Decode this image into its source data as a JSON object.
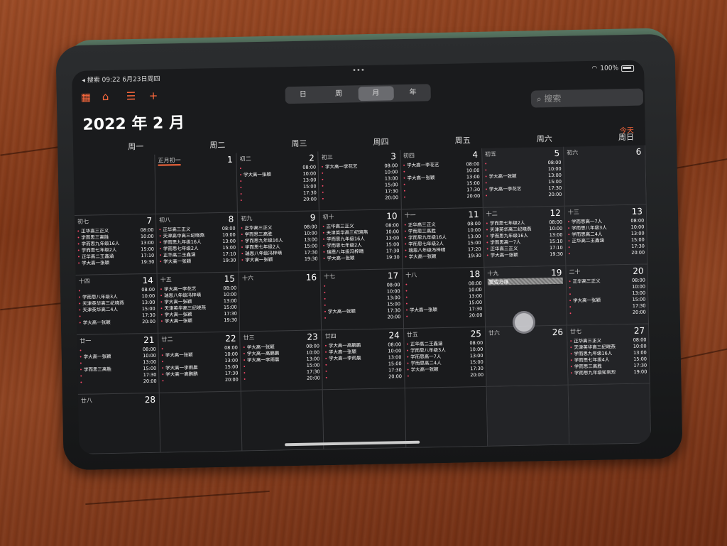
{
  "status": {
    "back": "◂ 搜索",
    "time": "09:22",
    "date": "6月23日周四",
    "battery": "100%"
  },
  "toolbar": {
    "seg": [
      "日",
      "周",
      "月",
      "年"
    ],
    "selected": 2,
    "search_placeholder": "搜索"
  },
  "month_title": "2022 年 2 月",
  "today_label": "今天",
  "weekdays": [
    "周一",
    "周二",
    "周三",
    "周四",
    "周五",
    "周六",
    "周日"
  ],
  "times_a": [
    "08:00",
    "10:00",
    "13:00",
    "15:00",
    "17:30",
    "20:00"
  ],
  "rows": [
    [
      {
        "lunar": "",
        "num": "",
        "ev": []
      },
      {
        "lunar": "正月初一",
        "num": "1",
        "hl": true,
        "ev": []
      },
      {
        "lunar": "初二",
        "num": "2",
        "ev": [
          [
            "",
            "08:00"
          ],
          [
            "学大高一张颖",
            "10:00"
          ],
          [
            "",
            "13:00"
          ],
          [
            "",
            "15:00"
          ],
          [
            "",
            "17:30"
          ],
          [
            "",
            "20:00"
          ]
        ]
      },
      {
        "lunar": "初三",
        "num": "3",
        "ev": [
          [
            "学大高一李花艺",
            "08:00"
          ],
          [
            "",
            "10:00"
          ],
          [
            "",
            "13:00"
          ],
          [
            "",
            "15:00"
          ],
          [
            "",
            "17:30"
          ],
          [
            "",
            "20:00"
          ]
        ]
      },
      {
        "lunar": "初四",
        "num": "4",
        "ev": [
          [
            "学大高一李花艺",
            "08:00"
          ],
          [
            "",
            "10:00"
          ],
          [
            "学大高一张颖",
            "13:00"
          ],
          [
            "",
            "15:00"
          ],
          [
            "",
            "17:30"
          ],
          [
            "",
            "20:00"
          ]
        ]
      },
      {
        "lunar": "初五",
        "num": "5",
        "ev": [
          [
            "",
            "08:00"
          ],
          [
            "",
            "10:00"
          ],
          [
            "学大高一张颖",
            "13:00"
          ],
          [
            "",
            "15:00"
          ],
          [
            "学大高一李花艺",
            "17:30"
          ],
          [
            "",
            "20:00"
          ]
        ]
      },
      {
        "lunar": "初六",
        "num": "6",
        "ev": []
      }
    ],
    [
      {
        "lunar": "初七",
        "num": "7",
        "ev": [
          [
            "正华高三正义",
            "08:00"
          ],
          [
            "学而思三高胜",
            "10:00"
          ],
          [
            "学而思九年级16人",
            "13:00"
          ],
          [
            "学而思七年级2人",
            "15:00"
          ],
          [
            "正华高二王鑫涵",
            "17:10"
          ],
          [
            "学大高一张颖",
            "19:30"
          ]
        ]
      },
      {
        "lunar": "初八",
        "num": "8",
        "ev": [
          [
            "正华高三正义",
            "08:00"
          ],
          [
            "天津高中高三纪晓燕",
            "10:00"
          ],
          [
            "学而思九年级16人",
            "13:00"
          ],
          [
            "学而思七年级2人",
            "15:00"
          ],
          [
            "正华高二王鑫涵",
            "17:10"
          ],
          [
            "学大高一张颖",
            "19:30"
          ]
        ]
      },
      {
        "lunar": "初九",
        "num": "9",
        "ev": [
          [
            "正华高三正义",
            "08:00"
          ],
          [
            "学而思三高胜",
            "10:00"
          ],
          [
            "学而思九年级16人",
            "13:00"
          ],
          [
            "学而思七年级2人",
            "15:00"
          ],
          [
            "瑞恩八年级冯梓晴",
            "17:30"
          ],
          [
            "学大高一张颖",
            "19:30"
          ]
        ]
      },
      {
        "lunar": "初十",
        "num": "10",
        "ev": [
          [
            "正华高三正义",
            "08:00"
          ],
          [
            "天津英华高三纪晓燕",
            "10:00"
          ],
          [
            "学而思九年级16人",
            "13:00"
          ],
          [
            "学而思七年级2人",
            "15:00"
          ],
          [
            "瑞恩八年级冯梓晴",
            "17:30"
          ],
          [
            "学大高一张颖",
            "19:30"
          ]
        ]
      },
      {
        "lunar": "十一",
        "num": "11",
        "ev": [
          [
            "正华高三正义",
            "08:00"
          ],
          [
            "学而思三高胜",
            "10:00"
          ],
          [
            "学而思九年级16人",
            "13:00"
          ],
          [
            "学而思七年级2人",
            "15:00"
          ],
          [
            "瑞恩八年级冯梓晴",
            "17:20"
          ],
          [
            "学大高一张颖",
            "19:30"
          ]
        ]
      },
      {
        "lunar": "十二",
        "num": "12",
        "ev": [
          [
            "学而思七年级2人",
            "08:00"
          ],
          [
            "天津英华高三纪晓燕",
            "10:00"
          ],
          [
            "学而思九年级16人",
            "13:00"
          ],
          [
            "学而思高一7人",
            "15:10"
          ],
          [
            "正华高三正义",
            "17:10"
          ],
          [
            "学大高一张颖",
            "19:30"
          ]
        ]
      },
      {
        "lunar": "十三",
        "num": "13",
        "ev": [
          [
            "学而思高一7人",
            "08:00"
          ],
          [
            "学而思八年级3人",
            "10:00"
          ],
          [
            "学而思高二4人",
            "13:00"
          ],
          [
            "正华高二王鑫涵",
            "15:00"
          ],
          [
            "",
            "17:30"
          ],
          [
            "",
            "20:00"
          ]
        ]
      }
    ],
    [
      {
        "lunar": "十四",
        "num": "14",
        "ev": [
          [
            "",
            "08:00"
          ],
          [
            "学而思八年级3人",
            "10:00"
          ],
          [
            "天津英华高三纪晓燕",
            "13:00"
          ],
          [
            "天津英华高二4人",
            "15:00"
          ],
          [
            "",
            "17:30"
          ],
          [
            "学大高一张颖",
            "20:00"
          ]
        ]
      },
      {
        "lunar": "十五",
        "num": "15",
        "ev": [
          [
            "学大高一李花艺",
            "08:00"
          ],
          [
            "瑞恩八年级冯梓晴",
            "10:00"
          ],
          [
            "学大高一张颖",
            "13:00"
          ],
          [
            "天津英华高三纪晓燕",
            "15:00"
          ],
          [
            "学大高一张颖",
            "17:30"
          ],
          [
            "学大高一张颖",
            "19:30"
          ]
        ]
      },
      {
        "lunar": "十六",
        "num": "16",
        "ev": []
      },
      {
        "lunar": "十七",
        "num": "17",
        "ev": [
          [
            "",
            "08:00"
          ],
          [
            "",
            "10:00"
          ],
          [
            "",
            "13:00"
          ],
          [
            "",
            "15:00"
          ],
          [
            "学大高一张颖",
            "17:30"
          ],
          [
            "",
            "20:00"
          ]
        ]
      },
      {
        "lunar": "十八",
        "num": "18",
        "ev": [
          [
            "",
            "08:00"
          ],
          [
            "",
            "10:00"
          ],
          [
            "",
            "13:00"
          ],
          [
            "",
            "15:00"
          ],
          [
            "学大高一张颖",
            "17:30"
          ],
          [
            "",
            "20:00"
          ]
        ]
      },
      {
        "lunar": "十九",
        "num": "19",
        "allday": "雷佐万维",
        "ev": []
      },
      {
        "lunar": "二十",
        "num": "20",
        "ev": [
          [
            "正华高三正义",
            "08:00"
          ],
          [
            "",
            "10:00"
          ],
          [
            "",
            "13:00"
          ],
          [
            "学大高一张颖",
            "15:00"
          ],
          [
            "",
            "17:30"
          ],
          [
            "",
            "20:00"
          ]
        ]
      }
    ],
    [
      {
        "lunar": "廿一",
        "num": "21",
        "ev": [
          [
            "",
            "08:00"
          ],
          [
            "学大高一张颖",
            "10:00"
          ],
          [
            "",
            "13:00"
          ],
          [
            "学而思三高胜",
            "15:00"
          ],
          [
            "",
            "17:30"
          ],
          [
            "",
            "20:00"
          ]
        ]
      },
      {
        "lunar": "廿二",
        "num": "22",
        "ev": [
          [
            "",
            "08:00"
          ],
          [
            "学大高一张颖",
            "10:00"
          ],
          [
            "",
            "13:00"
          ],
          [
            "学大高一李雨晨",
            "15:00"
          ],
          [
            "学大高一高鹏鹏",
            "17:30"
          ],
          [
            "",
            "20:00"
          ]
        ]
      },
      {
        "lunar": "廿三",
        "num": "23",
        "ev": [
          [
            "学大高一张颖",
            "08:00"
          ],
          [
            "学大高一高鹏鹏",
            "10:00"
          ],
          [
            "学大高一李雨晨",
            "13:00"
          ],
          [
            "",
            "15:00"
          ],
          [
            "",
            "17:30"
          ],
          [
            "",
            "20:00"
          ]
        ]
      },
      {
        "lunar": "廿四",
        "num": "24",
        "ev": [
          [
            "学大高一高鹏鹏",
            "08:00"
          ],
          [
            "学大高一张颖",
            "10:00"
          ],
          [
            "学大高一李雨晨",
            "13:00"
          ],
          [
            "",
            "15:00"
          ],
          [
            "",
            "17:30"
          ],
          [
            "",
            "20:00"
          ]
        ]
      },
      {
        "lunar": "廿五",
        "num": "25",
        "ev": [
          [
            "正华高二王鑫涵",
            "08:00"
          ],
          [
            "学而思八年级3人",
            "10:00"
          ],
          [
            "学而思高一7人",
            "13:00"
          ],
          [
            "学而思高二4人",
            "15:00"
          ],
          [
            "学大高一张颖",
            "17:30"
          ],
          [
            "",
            "20:00"
          ]
        ]
      },
      {
        "lunar": "廿六",
        "num": "26",
        "ev": []
      },
      {
        "lunar": "廿七",
        "num": "27",
        "ev": [
          [
            "正华高三正义",
            "08:00"
          ],
          [
            "天津英华高三纪晓燕",
            "10:00"
          ],
          [
            "学而思九年级16人",
            "13:00"
          ],
          [
            "学而思七年级4人",
            "15:00"
          ],
          [
            "学而思三高胜",
            "17:30"
          ],
          [
            "学而思九年级知到形",
            "19:00"
          ]
        ]
      }
    ],
    [
      {
        "lunar": "廿八",
        "num": "28",
        "ev": []
      },
      {
        "lunar": "",
        "num": "",
        "ev": []
      },
      {
        "lunar": "",
        "num": "",
        "ev": []
      },
      {
        "lunar": "",
        "num": "",
        "ev": []
      },
      {
        "lunar": "",
        "num": "",
        "ev": []
      },
      {
        "lunar": "",
        "num": "",
        "ev": []
      },
      {
        "lunar": "",
        "num": "",
        "ev": []
      }
    ]
  ]
}
